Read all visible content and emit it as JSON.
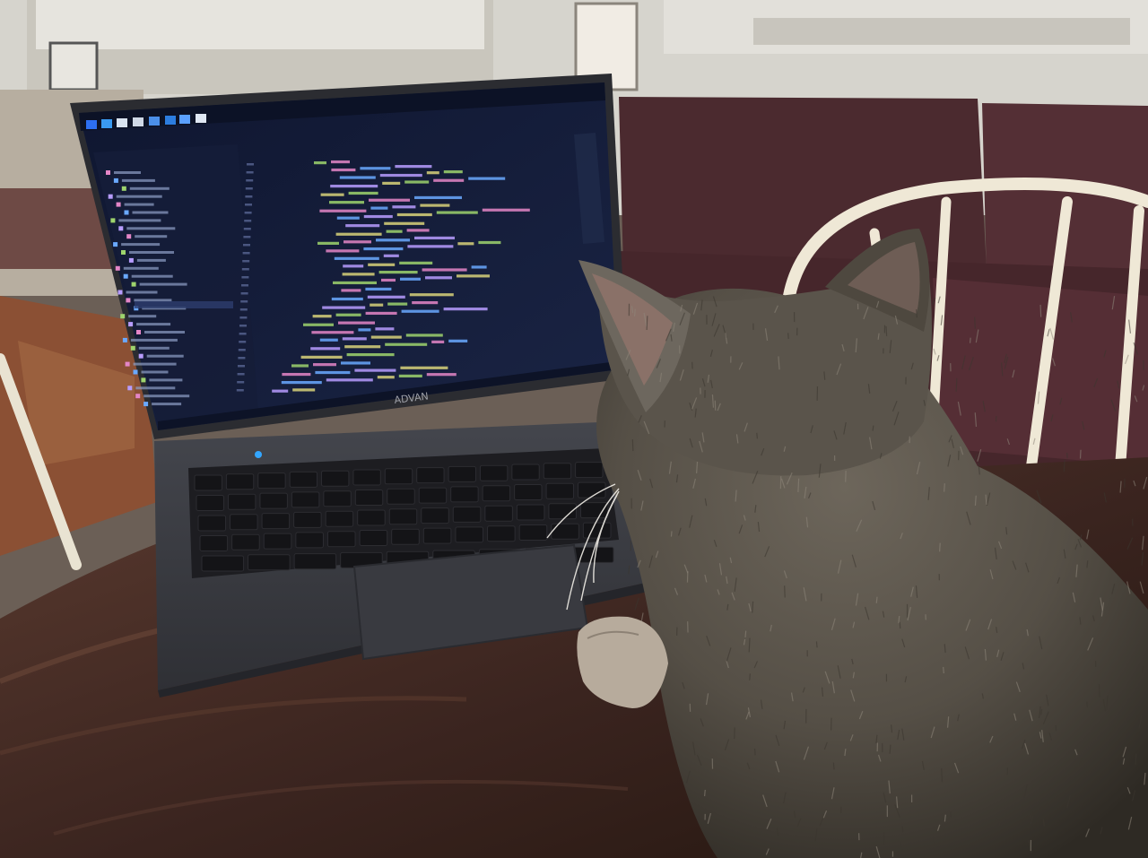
{
  "scene": {
    "laptop": {
      "brand_text": "ADVAN",
      "editor": {
        "window_title": "",
        "code_lines_count": 29
      }
    }
  },
  "colors": {
    "wall": "#d8d6cf",
    "sofa": "#4a2a2e",
    "sofa_light": "#5d3339",
    "table": "#3b2722",
    "table_highlight": "#5b3c31",
    "floor": "#8e5436",
    "chair": "#efe9d8",
    "laptop_body": "#3a3b40",
    "screen_bg": "#131b33",
    "screen_panel": "#1a223d",
    "keyboard": "#1c1c20",
    "cat_fur": "#5a544c",
    "cat_dark": "#3b362f",
    "cat_light": "#8f877b",
    "ear_inner": "#7a5a52",
    "code_green": "#9ed46d",
    "code_pink": "#e486c7",
    "code_blue": "#6aa9ff",
    "code_purple": "#b79cff",
    "code_yellow": "#d8d27a"
  }
}
